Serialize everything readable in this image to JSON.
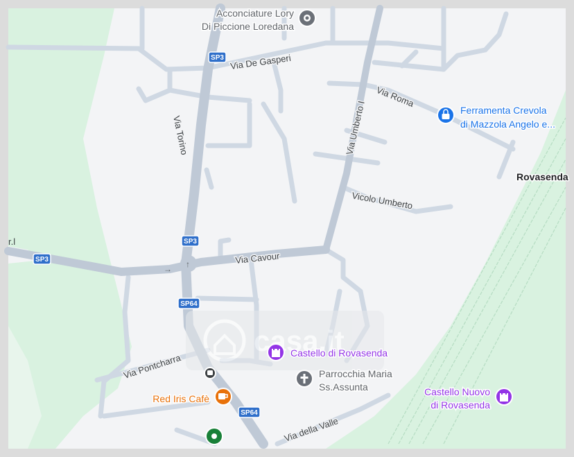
{
  "colors": {
    "frame": "#dcdcdc",
    "land": "#f3f4f6",
    "park": "#d9f2e0",
    "road": "#cfd8e3",
    "main_road": "#bfc9d6",
    "railway": "#b9e0c6",
    "shield": "#2f6fca",
    "poi_gray": "#6b7078",
    "poi_blue": "#1a73e8",
    "poi_purple": "#9334e6",
    "poi_orange": "#e8710a",
    "poi_green": "#188038",
    "watermark": "#d0d3d8"
  },
  "streets": {
    "via_de_gasperi": "Via De Gasperi",
    "via_torino": "Via Torino",
    "via_roma": "Via Roma",
    "via_umberto": "Via Umberto I",
    "vicolo_umberto": "Vicolo Umberto",
    "via_cavour": "Via Cavour",
    "via_pontcharra": "Via Pontcharra",
    "via_della_valle": "Via della Valle"
  },
  "road_shields": {
    "sp3_top": "SP3",
    "sp3_middle": "SP3",
    "sp3_left": "SP3",
    "sp64_middle": "SP64",
    "sp64_bottom": "SP64"
  },
  "pois": {
    "acconciature": {
      "line1": "Acconciature Lory",
      "line2": "Di Piccione Loredana",
      "icon": "location-dot-icon"
    },
    "ferramenta": {
      "line1": "Ferramenta Crevola",
      "line2": "di Mazzola Angelo e...",
      "icon": "shopping-bag-icon"
    },
    "castello": {
      "label": "Castello di Rovasenda",
      "icon": "castle-icon"
    },
    "parrocchia": {
      "line1": "Parrocchia Maria",
      "line2": "Ss.Assunta",
      "icon": "church-cross-icon"
    },
    "castello_nuovo": {
      "line1": "Castello Nuovo",
      "line2": "di Rovasenda",
      "icon": "castle-icon"
    },
    "red_iris": {
      "label": "Red Iris Cafè",
      "icon": "coffee-cup-icon"
    },
    "green_pin": {
      "icon": "green-place-icon"
    },
    "bus_stop": {
      "icon": "bus-stop-icon"
    }
  },
  "places": {
    "rovasenda": "Rovasenda",
    "cut_label": "r.l"
  },
  "watermark": "casa.it"
}
